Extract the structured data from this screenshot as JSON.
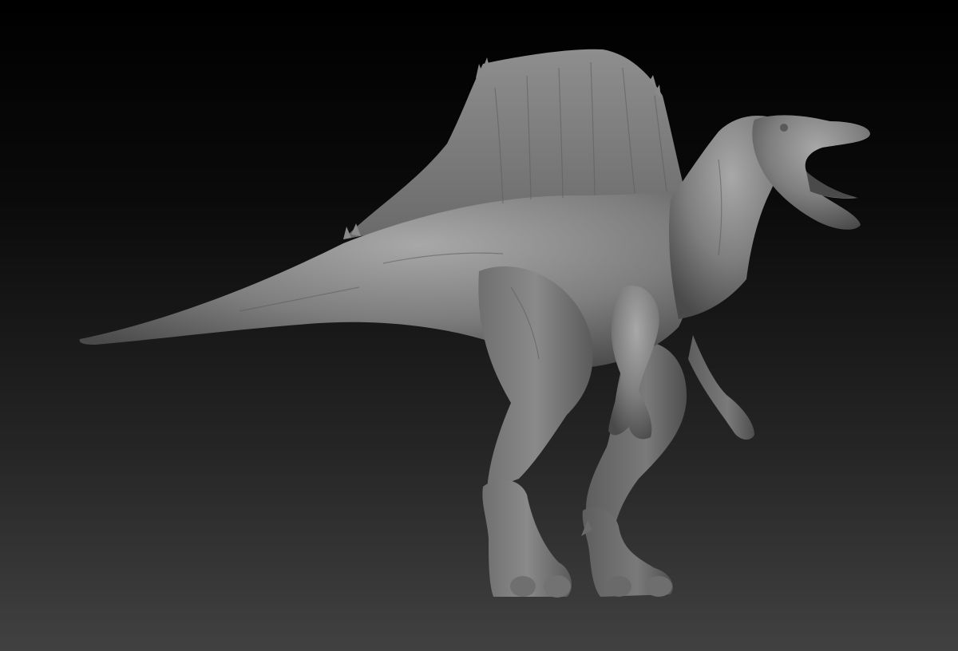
{
  "scene": {
    "subject": "spinosaurus-sculpt",
    "background_top": "#000000",
    "background_bottom": "#414141",
    "clay_base": "#7f7f7f",
    "clay_highlight": "#a6a6a6",
    "clay_shadow": "#3d3d3d"
  }
}
